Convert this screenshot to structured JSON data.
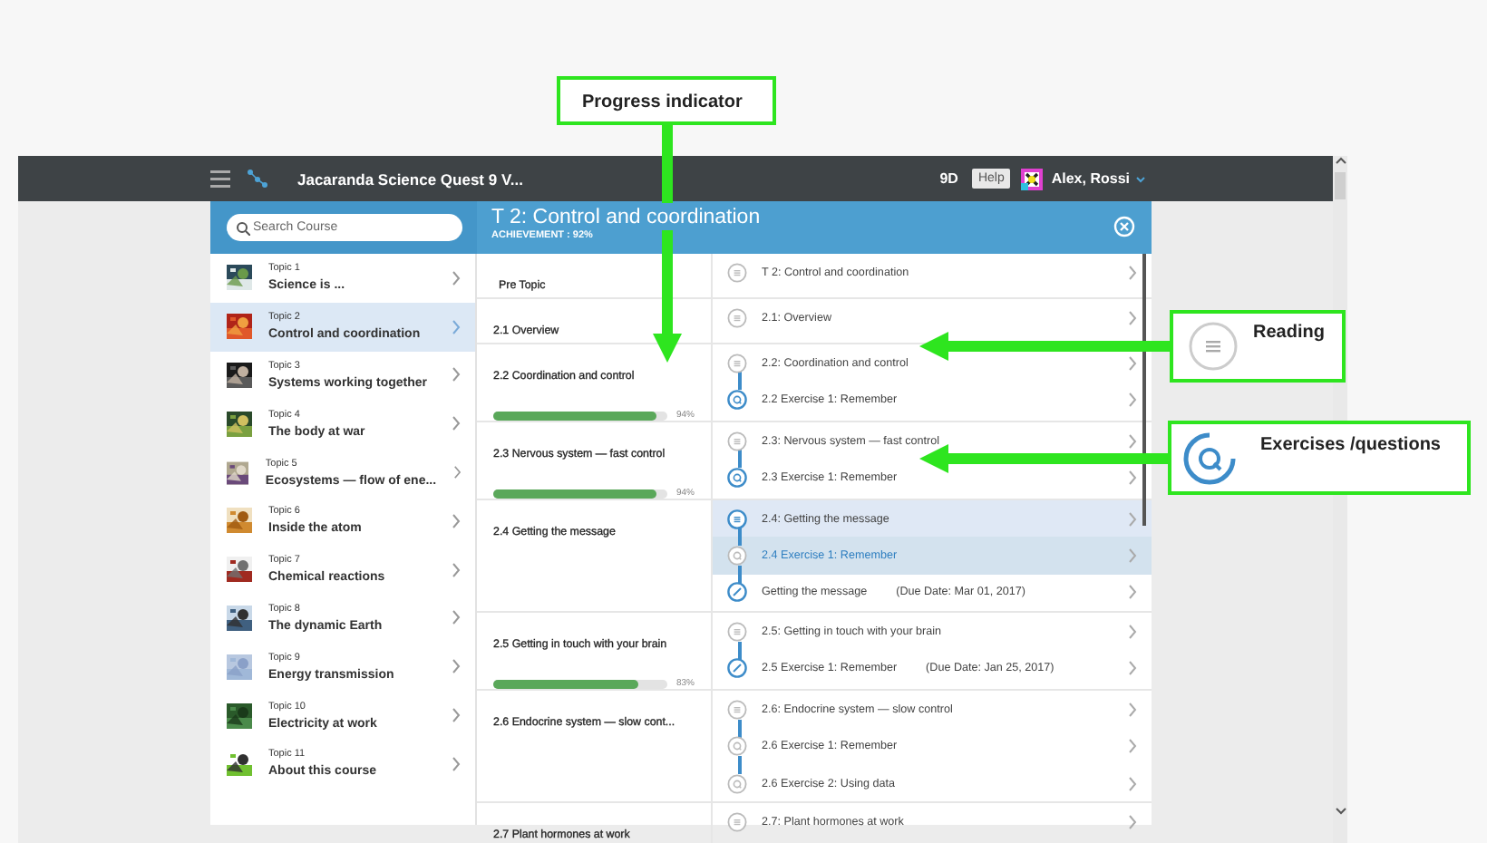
{
  "topbar": {
    "title": "Jacaranda Science Quest 9 V...",
    "class": "9D",
    "help": "Help",
    "user": "Alex, Rossi"
  },
  "search": {
    "placeholder": "Search Course"
  },
  "header": {
    "title": "T 2: Control and coordination",
    "achievement": "ACHIEVEMENT : 92%"
  },
  "topics": [
    {
      "label": "Topic 1",
      "title": "Science is ...",
      "selected": false
    },
    {
      "label": "Topic 2",
      "title": "Control and coordination",
      "selected": true
    },
    {
      "label": "Topic 3",
      "title": "Systems working together",
      "selected": false
    },
    {
      "label": "Topic 4",
      "title": "The body at war",
      "selected": false
    },
    {
      "label": "Topic 5",
      "title": "Ecosystems — flow of ene...",
      "selected": false
    },
    {
      "label": "Topic 6",
      "title": "Inside the atom",
      "selected": false
    },
    {
      "label": "Topic 7",
      "title": "Chemical reactions",
      "selected": false
    },
    {
      "label": "Topic 8",
      "title": "The dynamic Earth",
      "selected": false
    },
    {
      "label": "Topic 9",
      "title": "Energy transmission",
      "selected": false
    },
    {
      "label": "Topic 10",
      "title": "Electricity at work",
      "selected": false
    },
    {
      "label": "Topic 11",
      "title": "About this course",
      "selected": false
    }
  ],
  "sections": [
    {
      "title": "Pre Topic",
      "items": [
        {
          "kind": "reading",
          "text": "T 2: Control and coordination",
          "done": false,
          "highlighted": false,
          "selected": false
        }
      ]
    },
    {
      "title": "2.1 Overview",
      "items": [
        {
          "kind": "reading",
          "text": "2.1: Overview",
          "done": false,
          "highlighted": false,
          "selected": false
        }
      ]
    },
    {
      "title": "2.2 Coordination and control",
      "progress": {
        "level": 0.94,
        "reading": "94%"
      },
      "items": [
        {
          "kind": "reading",
          "text": "2.2: Coordination and control",
          "done": false,
          "highlighted": false,
          "selected": false
        },
        {
          "kind": "exercise",
          "text": "2.2 Exercise 1: Remember",
          "done": true,
          "highlighted": false,
          "selected": false
        }
      ]
    },
    {
      "title": "2.3 Nervous system — fast control",
      "progress": {
        "level": 0.94,
        "reading": "94%"
      },
      "items": [
        {
          "kind": "reading",
          "text": "2.3: Nervous system — fast control",
          "done": false,
          "highlighted": false,
          "selected": false
        },
        {
          "kind": "exercise",
          "text": "2.3 Exercise 1: Remember",
          "done": true,
          "highlighted": false,
          "selected": false
        }
      ]
    },
    {
      "title": "2.4 Getting the message",
      "items": [
        {
          "kind": "reading",
          "text": "2.4: Getting the message",
          "done": true,
          "highlighted": true,
          "selected": false
        },
        {
          "kind": "exercise",
          "text": "2.4 Exercise 1: Remember",
          "done": false,
          "highlighted": false,
          "selected": true
        },
        {
          "kind": "assignment",
          "text": "Getting the message",
          "due": "(Due Date: Mar 01, 2017)",
          "done": true,
          "highlighted": false,
          "selected": false
        }
      ]
    },
    {
      "title": "2.5 Getting in touch with your brain",
      "progress": {
        "level": 0.83,
        "reading": "83%"
      },
      "items": [
        {
          "kind": "reading",
          "text": "2.5: Getting in touch with your brain",
          "done": false,
          "highlighted": false,
          "selected": false
        },
        {
          "kind": "assignment",
          "text": "2.5 Exercise 1: Remember",
          "due": "(Due Date: Jan 25, 2017)",
          "done": true,
          "highlighted": false,
          "selected": false
        }
      ]
    },
    {
      "title": "2.6 Endocrine system — slow cont...",
      "items": [
        {
          "kind": "reading",
          "text": "2.6: Endocrine system — slow control",
          "done": false,
          "highlighted": false,
          "selected": false
        },
        {
          "kind": "exercise",
          "text": "2.6 Exercise 1: Remember",
          "done": false,
          "highlighted": false,
          "selected": false
        },
        {
          "kind": "exercise",
          "text": "2.6 Exercise 2: Using data",
          "done": false,
          "highlighted": false,
          "selected": false
        }
      ]
    },
    {
      "title": "2.7 Plant hormones at work",
      "items": [
        {
          "kind": "reading",
          "text": "2.7: Plant hormones at work",
          "done": false,
          "highlighted": false,
          "selected": false
        }
      ]
    }
  ],
  "callouts": [
    {
      "kind": "progress",
      "text": "Progress indicator"
    },
    {
      "kind": "reading",
      "text": "Reading"
    },
    {
      "kind": "exercise",
      "text": "Exercises /questions"
    }
  ]
}
